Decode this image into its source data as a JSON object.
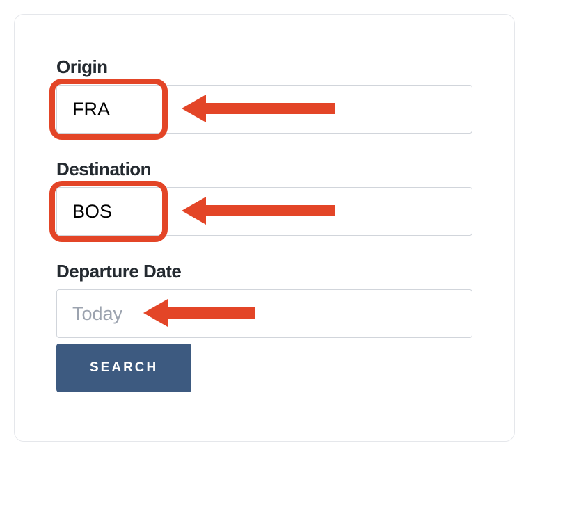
{
  "form": {
    "origin": {
      "label": "Origin",
      "value": "FRA"
    },
    "destination": {
      "label": "Destination",
      "value": "BOS"
    },
    "departure": {
      "label": "Departure Date",
      "placeholder": "Today",
      "value": ""
    },
    "search_button": "SEARCH"
  },
  "annotations": {
    "highlight_color": "#e34527"
  }
}
